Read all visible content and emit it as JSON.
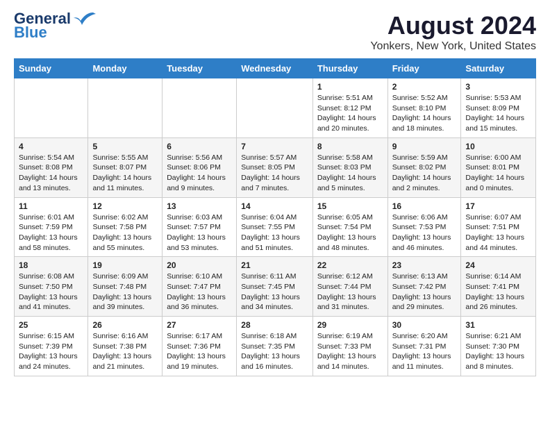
{
  "logo": {
    "line1": "General",
    "line2": "Blue"
  },
  "title": "August 2024",
  "subtitle": "Yonkers, New York, United States",
  "weekdays": [
    "Sunday",
    "Monday",
    "Tuesday",
    "Wednesday",
    "Thursday",
    "Friday",
    "Saturday"
  ],
  "weeks": [
    [
      {
        "day": "",
        "content": ""
      },
      {
        "day": "",
        "content": ""
      },
      {
        "day": "",
        "content": ""
      },
      {
        "day": "",
        "content": ""
      },
      {
        "day": "1",
        "content": "Sunrise: 5:51 AM\nSunset: 8:12 PM\nDaylight: 14 hours and 20 minutes."
      },
      {
        "day": "2",
        "content": "Sunrise: 5:52 AM\nSunset: 8:10 PM\nDaylight: 14 hours and 18 minutes."
      },
      {
        "day": "3",
        "content": "Sunrise: 5:53 AM\nSunset: 8:09 PM\nDaylight: 14 hours and 15 minutes."
      }
    ],
    [
      {
        "day": "4",
        "content": "Sunrise: 5:54 AM\nSunset: 8:08 PM\nDaylight: 14 hours and 13 minutes."
      },
      {
        "day": "5",
        "content": "Sunrise: 5:55 AM\nSunset: 8:07 PM\nDaylight: 14 hours and 11 minutes."
      },
      {
        "day": "6",
        "content": "Sunrise: 5:56 AM\nSunset: 8:06 PM\nDaylight: 14 hours and 9 minutes."
      },
      {
        "day": "7",
        "content": "Sunrise: 5:57 AM\nSunset: 8:05 PM\nDaylight: 14 hours and 7 minutes."
      },
      {
        "day": "8",
        "content": "Sunrise: 5:58 AM\nSunset: 8:03 PM\nDaylight: 14 hours and 5 minutes."
      },
      {
        "day": "9",
        "content": "Sunrise: 5:59 AM\nSunset: 8:02 PM\nDaylight: 14 hours and 2 minutes."
      },
      {
        "day": "10",
        "content": "Sunrise: 6:00 AM\nSunset: 8:01 PM\nDaylight: 14 hours and 0 minutes."
      }
    ],
    [
      {
        "day": "11",
        "content": "Sunrise: 6:01 AM\nSunset: 7:59 PM\nDaylight: 13 hours and 58 minutes."
      },
      {
        "day": "12",
        "content": "Sunrise: 6:02 AM\nSunset: 7:58 PM\nDaylight: 13 hours and 55 minutes."
      },
      {
        "day": "13",
        "content": "Sunrise: 6:03 AM\nSunset: 7:57 PM\nDaylight: 13 hours and 53 minutes."
      },
      {
        "day": "14",
        "content": "Sunrise: 6:04 AM\nSunset: 7:55 PM\nDaylight: 13 hours and 51 minutes."
      },
      {
        "day": "15",
        "content": "Sunrise: 6:05 AM\nSunset: 7:54 PM\nDaylight: 13 hours and 48 minutes."
      },
      {
        "day": "16",
        "content": "Sunrise: 6:06 AM\nSunset: 7:53 PM\nDaylight: 13 hours and 46 minutes."
      },
      {
        "day": "17",
        "content": "Sunrise: 6:07 AM\nSunset: 7:51 PM\nDaylight: 13 hours and 44 minutes."
      }
    ],
    [
      {
        "day": "18",
        "content": "Sunrise: 6:08 AM\nSunset: 7:50 PM\nDaylight: 13 hours and 41 minutes."
      },
      {
        "day": "19",
        "content": "Sunrise: 6:09 AM\nSunset: 7:48 PM\nDaylight: 13 hours and 39 minutes."
      },
      {
        "day": "20",
        "content": "Sunrise: 6:10 AM\nSunset: 7:47 PM\nDaylight: 13 hours and 36 minutes."
      },
      {
        "day": "21",
        "content": "Sunrise: 6:11 AM\nSunset: 7:45 PM\nDaylight: 13 hours and 34 minutes."
      },
      {
        "day": "22",
        "content": "Sunrise: 6:12 AM\nSunset: 7:44 PM\nDaylight: 13 hours and 31 minutes."
      },
      {
        "day": "23",
        "content": "Sunrise: 6:13 AM\nSunset: 7:42 PM\nDaylight: 13 hours and 29 minutes."
      },
      {
        "day": "24",
        "content": "Sunrise: 6:14 AM\nSunset: 7:41 PM\nDaylight: 13 hours and 26 minutes."
      }
    ],
    [
      {
        "day": "25",
        "content": "Sunrise: 6:15 AM\nSunset: 7:39 PM\nDaylight: 13 hours and 24 minutes."
      },
      {
        "day": "26",
        "content": "Sunrise: 6:16 AM\nSunset: 7:38 PM\nDaylight: 13 hours and 21 minutes."
      },
      {
        "day": "27",
        "content": "Sunrise: 6:17 AM\nSunset: 7:36 PM\nDaylight: 13 hours and 19 minutes."
      },
      {
        "day": "28",
        "content": "Sunrise: 6:18 AM\nSunset: 7:35 PM\nDaylight: 13 hours and 16 minutes."
      },
      {
        "day": "29",
        "content": "Sunrise: 6:19 AM\nSunset: 7:33 PM\nDaylight: 13 hours and 14 minutes."
      },
      {
        "day": "30",
        "content": "Sunrise: 6:20 AM\nSunset: 7:31 PM\nDaylight: 13 hours and 11 minutes."
      },
      {
        "day": "31",
        "content": "Sunrise: 6:21 AM\nSunset: 7:30 PM\nDaylight: 13 hours and 8 minutes."
      }
    ]
  ]
}
